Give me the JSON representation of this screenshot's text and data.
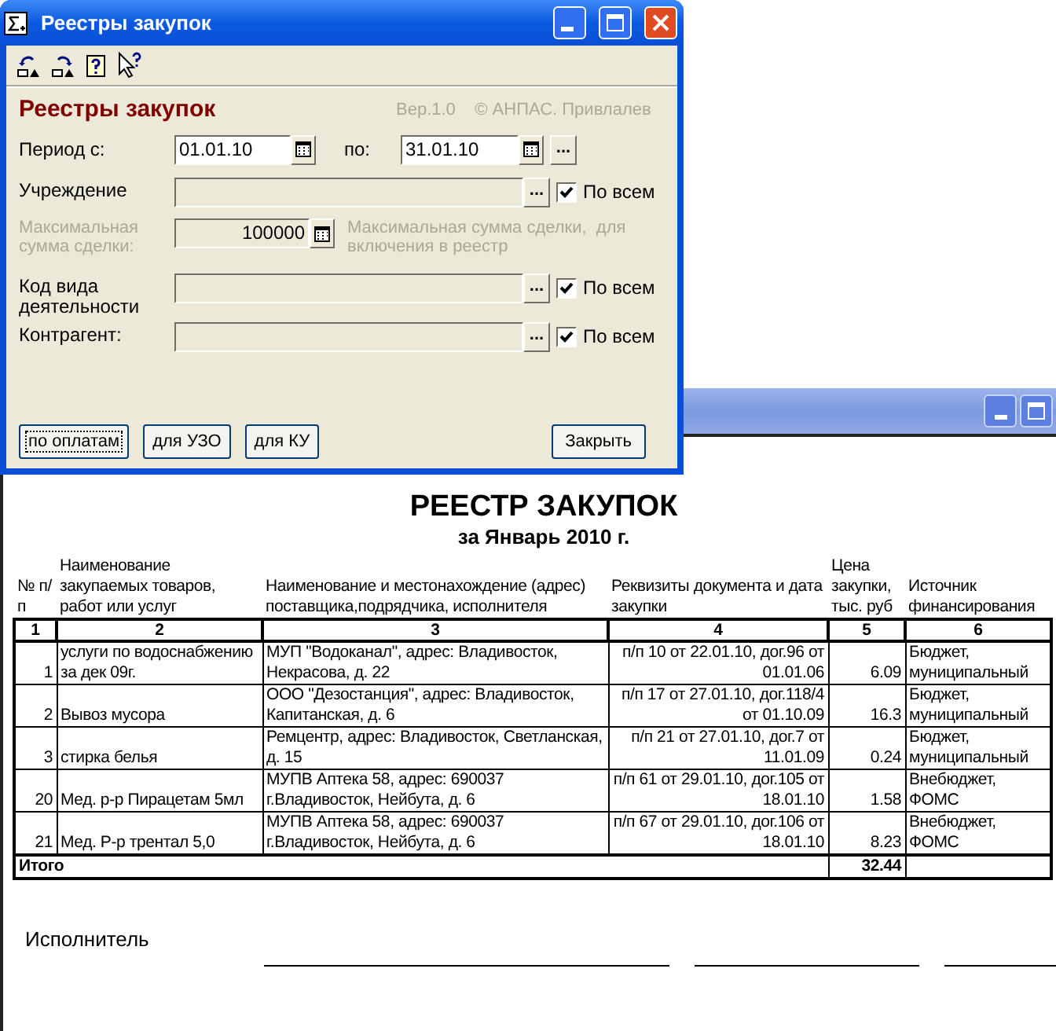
{
  "dialog": {
    "title": "Реестры закупок",
    "heading": "Реестры закупок",
    "version": "Вер.1.0    © АНПАС. Привлалев",
    "period": {
      "label": "Период с:",
      "from": "01.01.10",
      "to_label": "по:",
      "to": "31.01.10",
      "browse": "..."
    },
    "fields": [
      {
        "kind": "lookup",
        "label": "Учреждение",
        "browse": "...",
        "checked": true,
        "check_label": "По всем"
      },
      {
        "kind": "amount",
        "label": "Максимальная сумма сделки:",
        "value": "100000",
        "disabled": true,
        "note": "Максимальная сумма сделки,  для включения в реестр"
      },
      {
        "kind": "lookup",
        "label": "Код вида деятельности",
        "browse": "...",
        "checked": true,
        "check_label": "По всем"
      },
      {
        "kind": "lookup",
        "label": "Контрагент:",
        "browse": "...",
        "checked": true,
        "check_label": "По всем"
      }
    ],
    "buttons": [
      {
        "label": "по оплатам",
        "focused": true
      },
      {
        "label": "для УЗО",
        "focused": false
      },
      {
        "label": "для КУ",
        "focused": false
      }
    ],
    "close_button": "Закрыть"
  },
  "report": {
    "title": "РЕЕСТР ЗАКУПОК",
    "subtitle": "за Январь 2010 г.",
    "columns": [
      {
        "heading": "№ п/п",
        "number": "1"
      },
      {
        "heading": "Наименование закупаемых товаров, работ или услуг",
        "number": "2"
      },
      {
        "heading": "Наименование и местонахождение (адрес) поставщика,подрядчика, исполнителя",
        "number": "3"
      },
      {
        "heading": "Реквизиты документа и дата закупки",
        "number": "4"
      },
      {
        "heading": "Цена закупки, тыс. руб",
        "number": "5"
      },
      {
        "heading": "Источник финансирования",
        "number": "6"
      }
    ],
    "rows": [
      [
        "1",
        "услуги по водоснабжению за дек 09г.",
        "МУП \"Водоканал\", адрес: Владивосток, Некрасова, д. 22",
        "п/п 10 от 22.01.10, дог.96 от 01.01.06",
        "6.09",
        "Бюджет, муниципальный"
      ],
      [
        "2",
        "Вывоз мусора",
        "ООО \"Дезостанция\", адрес: Владивосток, Капитанская, д. 6",
        "п/п 17 от 27.01.10, дог.118/4 от 01.10.09",
        "16.3",
        "Бюджет, муниципальный"
      ],
      [
        "3",
        "стирка белья",
        "Ремцентр, адрес: Владивосток, Светланская, д. 15",
        "п/п 21 от 27.01.10, дог.7 от 11.01.09",
        "0.24",
        "Бюджет, муниципальный"
      ],
      [
        "20",
        "Мед. р-р Пирацетам 5мл",
        "МУПВ Аптека  58, адрес: 690037 г.Владивосток, Нейбута, д. 6",
        "п/п 61 от 29.01.10, дог.105 от 18.01.10",
        "1.58",
        "Внебюджет, ФОМС"
      ],
      [
        "21",
        "Мед. Р-р трентал 5,0",
        "МУПВ Аптека  58, адрес: 690037 г.Владивосток, Нейбута, д. 6",
        "п/п 67 от 29.01.10, дог.106 от 18.01.10",
        "8.23",
        "Внебюджет, ФОМС"
      ]
    ],
    "total": {
      "label": "Итого",
      "value": "32.44"
    },
    "signature_label": "Исполнитель"
  }
}
